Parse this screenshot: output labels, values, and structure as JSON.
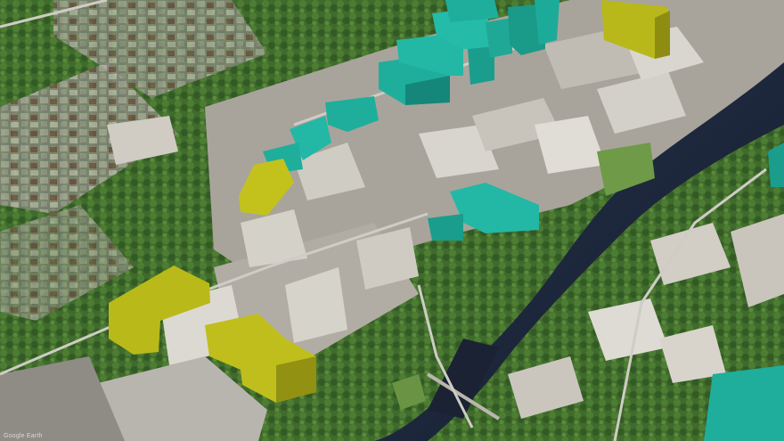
{
  "scene": {
    "colors": {
      "vegetation": "#3f6b2c",
      "vegetation_dark": "#2e5220",
      "urban_ground": "#9a968c",
      "rooftop_light": "#c9c6bf",
      "canal_water": "#1f2a3f",
      "teal_massing": "#1fae9c",
      "teal_massing_shade": "#14877a",
      "olive_massing": "#b9b81a",
      "olive_massing_shade": "#8e8d12",
      "parking": "#8c8a86"
    },
    "attribution": "Google Earth"
  }
}
